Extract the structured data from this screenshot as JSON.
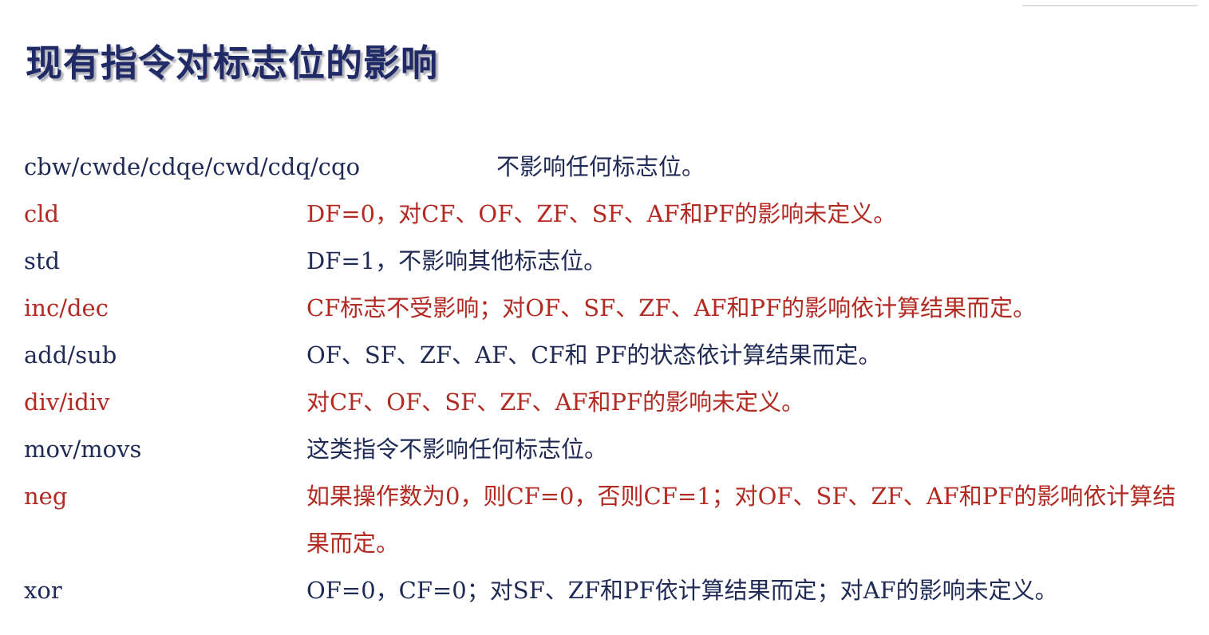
{
  "title": "现有指令对标志位的影响",
  "colors": {
    "title": "#1f2a66",
    "navy_text": "#1f2a55",
    "red_text": "#b22a22"
  },
  "rows": [
    {
      "instruction": "cbw/cwde/cdqe/cwd/cdq/cqo",
      "effect": "不影响任何标志位。",
      "color": "navy"
    },
    {
      "instruction": "cld",
      "effect": "DF=0，对CF、OF、ZF、SF、AF和PF的影响未定义。",
      "color": "red"
    },
    {
      "instruction": "std",
      "effect": "DF=1，不影响其他标志位。",
      "color": "navy"
    },
    {
      "instruction": "inc/dec",
      "effect": "CF标志不受影响；对OF、SF、ZF、AF和PF的影响依计算结果而定。",
      "color": "red"
    },
    {
      "instruction": "add/sub",
      "effect": "OF、SF、ZF、AF、CF和 PF的状态依计算结果而定。",
      "color": "navy"
    },
    {
      "instruction": "div/idiv",
      "effect": "对CF、OF、SF、ZF、AF和PF的影响未定义。",
      "color": "red"
    },
    {
      "instruction": "mov/movs",
      "effect": "这类指令不影响任何标志位。",
      "color": "navy"
    },
    {
      "instruction": "neg",
      "effect": "如果操作数为0，则CF=0，否则CF=1；对OF、SF、ZF、AF和PF的影响依计算结果而定。",
      "color": "red"
    },
    {
      "instruction": "xor",
      "effect": "OF=0，CF=0；对SF、ZF和PF依计算结果而定；对AF的影响未定义。",
      "color": "navy"
    }
  ]
}
